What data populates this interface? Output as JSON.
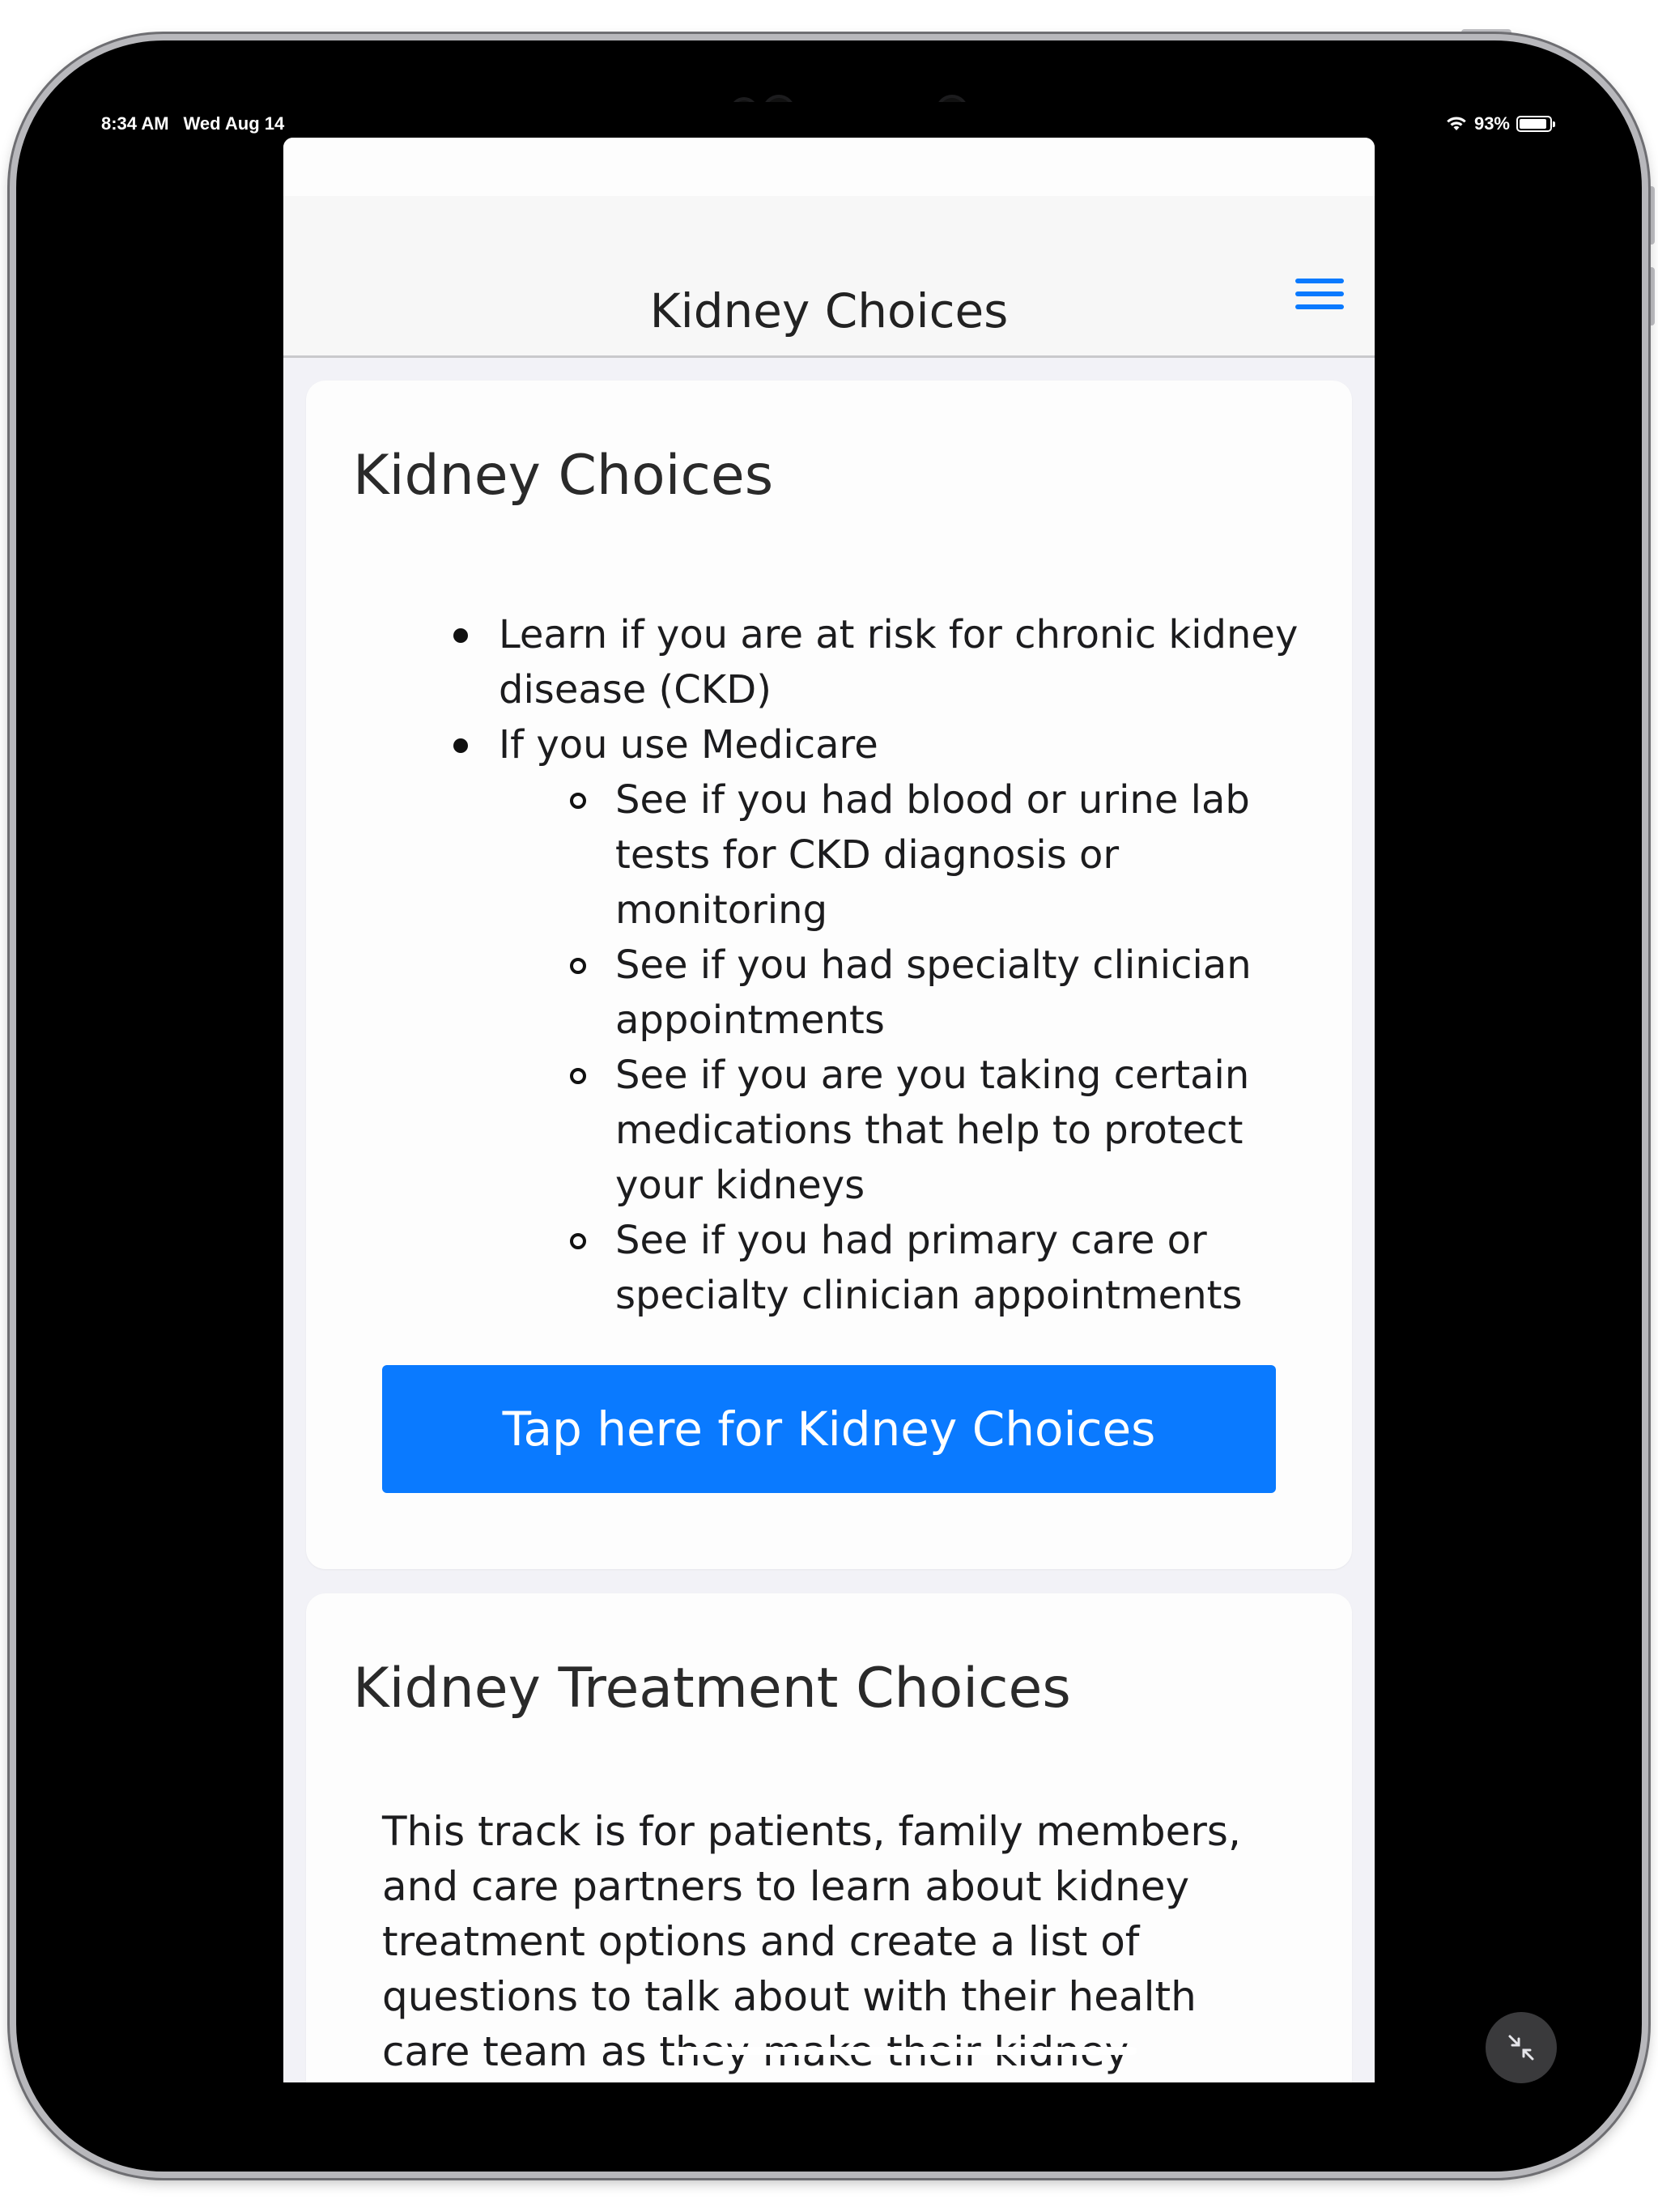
{
  "status_bar": {
    "time": "8:34 AM",
    "date": "Wed Aug 14",
    "battery": "93%",
    "battery_level": 0.93
  },
  "nav": {
    "title": "Kidney Choices",
    "menu_icon": "hamburger-menu-icon"
  },
  "card_kidney_choices": {
    "title": "Kidney Choices",
    "items": [
      {
        "text": "Learn if you are at risk for chronic kidney disease (CKD)"
      },
      {
        "text": "If you use Medicare",
        "subitems": [
          "See if you had blood or urine lab tests for CKD diagnosis or monitoring",
          "See if you had specialty clinician appointments",
          "See if you are you taking certain medications that help to protect your kidneys",
          "See if you had primary care or specialty clinician appointments"
        ]
      }
    ],
    "button_label": "Tap here for Kidney Choices"
  },
  "card_treatment_choices": {
    "title": "Kidney Treatment Choices",
    "description": "This track is for patients, family members, and care partners to learn about kidney treatment options and create a list of questions to talk about with their health care team as they make their kidney treatment choices."
  },
  "colors": {
    "accent": "#0a7aff",
    "background": "#f2f2f7",
    "card": "#fdfdfd",
    "text": "#1c1c1e"
  }
}
